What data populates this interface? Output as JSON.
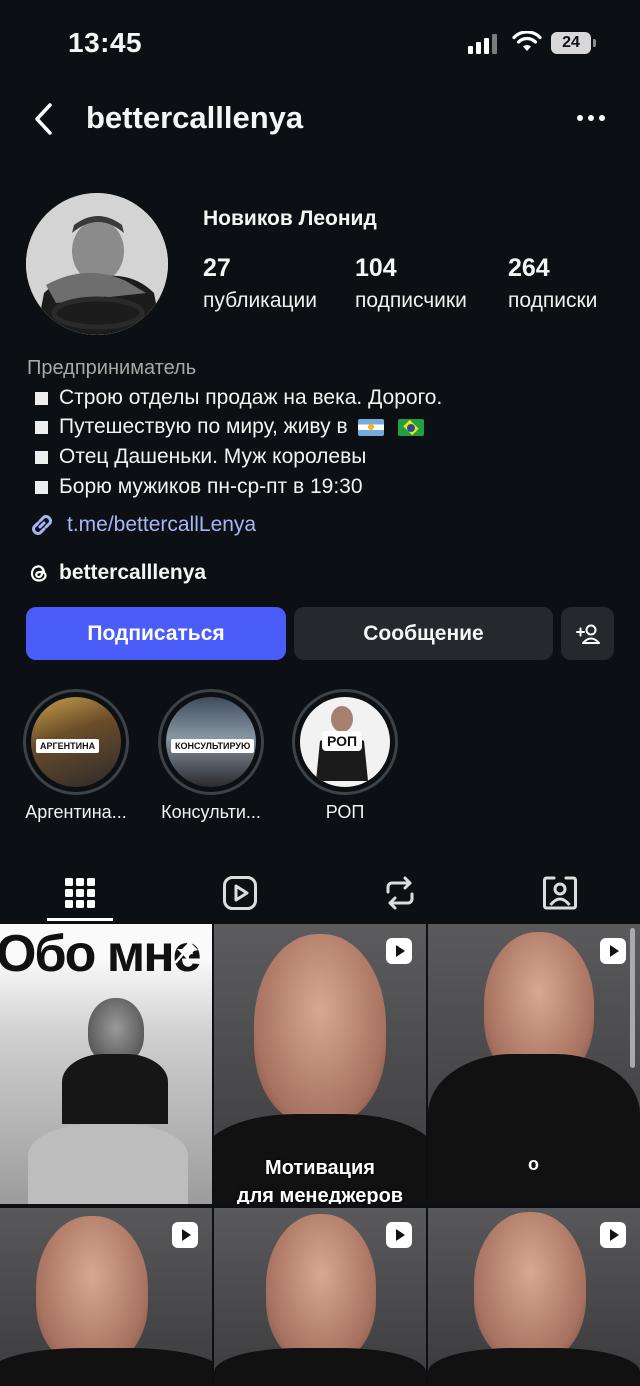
{
  "status": {
    "time": "13:45",
    "battery": "24"
  },
  "header": {
    "username": "bettercalllenya"
  },
  "profile": {
    "name": "Новиков Леонид",
    "stats": [
      {
        "value": "27",
        "label": "публикации"
      },
      {
        "value": "104",
        "label": "подписчики"
      },
      {
        "value": "264",
        "label": "подписки"
      }
    ],
    "category": "Предприниматель",
    "bio": [
      "Строю отделы продаж на века. Дорого.",
      "Путешествую по миру, живу в",
      "Отец Дашеньки. Муж королевы",
      "Борю мужиков пн-ср-пт в 19:30"
    ],
    "link": "t.me/bettercallLenya",
    "threads": "bettercalllenya"
  },
  "buttons": {
    "follow": "Подписаться",
    "message": "Сообщение"
  },
  "highlights": [
    {
      "label": "Аргентина...",
      "tag": "АРГЕНТИНА"
    },
    {
      "label": "Консульти...",
      "tag": "КОНСУЛЬТИРУЮ"
    },
    {
      "label": "РОП",
      "tag": "РОП"
    }
  ],
  "tabs": [
    "grid-icon",
    "reels-icon",
    "repost-icon",
    "tagged-icon"
  ],
  "posts": {
    "post1_title": "Обо мне",
    "post2_caption_1": "Мотивация",
    "post2_caption_2": "для менеджеров",
    "post3_caption": "о"
  },
  "colors": {
    "accent": "#4a5df9",
    "link": "#a6b6f5",
    "background": "#0c1014"
  }
}
